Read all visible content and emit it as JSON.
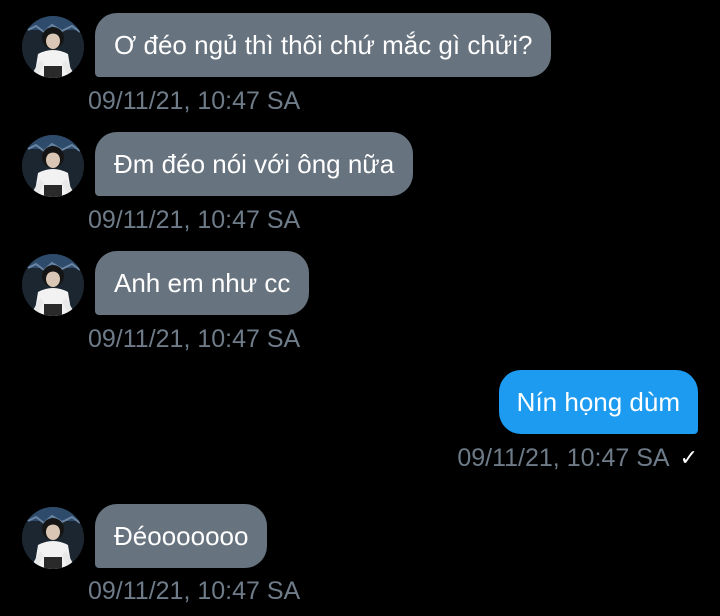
{
  "conversation": {
    "messages": [
      {
        "direction": "incoming",
        "text": "Ơ đéo ngủ thì thôi chứ mắc gì chửi?",
        "timestamp": "09/11/21, 10:47 SA",
        "avatar_icon": "user-avatar-icon"
      },
      {
        "direction": "incoming",
        "text": "Đm đéo nói với ông nữa",
        "timestamp": "09/11/21, 10:47 SA",
        "avatar_icon": "user-avatar-icon"
      },
      {
        "direction": "incoming",
        "text": "Anh em như cc",
        "timestamp": "09/11/21, 10:47 SA",
        "avatar_icon": "user-avatar-icon"
      },
      {
        "direction": "outgoing",
        "text": "Nín họng dùm",
        "timestamp": "09/11/21, 10:47 SA",
        "status_icon": "sent-check-icon",
        "status_glyph": "✓"
      },
      {
        "direction": "incoming",
        "text": "Đéooooooo",
        "timestamp": "09/11/21, 10:47 SA",
        "avatar_icon": "user-avatar-icon"
      }
    ]
  },
  "colors": {
    "background": "#000000",
    "incoming_bubble": "#67737f",
    "outgoing_bubble": "#1d9bf0",
    "timestamp_text": "#6e7b88",
    "message_text": "#ffffff"
  }
}
